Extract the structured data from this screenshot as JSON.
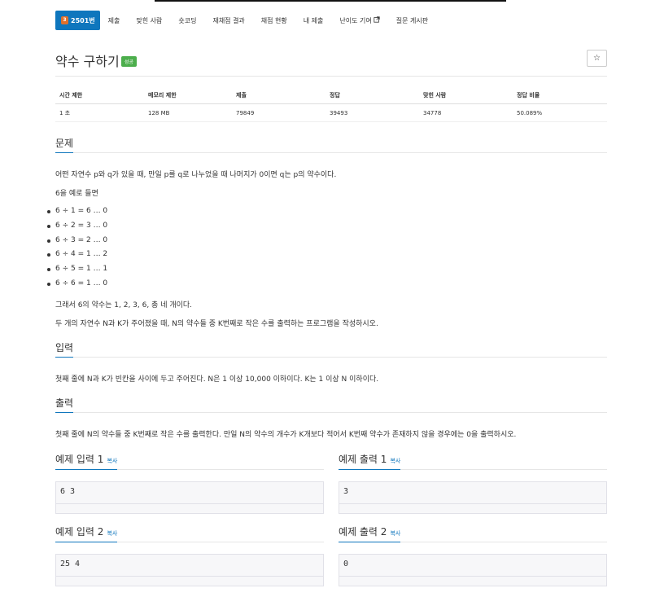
{
  "nav": {
    "problem_tab": {
      "badge": "3",
      "label": "2501번"
    },
    "tabs": [
      "제출",
      "맞힌 사람",
      "숏코딩",
      "재채점 결과",
      "채점 현황",
      "내 제출",
      "난이도 기여",
      "질문 게시판"
    ]
  },
  "problem": {
    "title": "약수 구하기",
    "status_label": "성공",
    "star": "☆"
  },
  "info": {
    "headers": [
      "시간 제한",
      "메모리 제한",
      "제출",
      "정답",
      "맞힌 사람",
      "정답 비율"
    ],
    "values": [
      "1 초",
      "128 MB",
      "79849",
      "39493",
      "34778",
      "50.089%"
    ]
  },
  "description": {
    "heading": "문제",
    "p1": "어떤 자연수 p와 q가 있을 때, 만일 p를 q로 나누었을 때 나머지가 0이면 q는 p의 약수이다.",
    "p2": "6을 예로 들면",
    "examples": [
      "6 ÷ 1 = 6 … 0",
      "6 ÷ 2 = 3 … 0",
      "6 ÷ 3 = 2 … 0",
      "6 ÷ 4 = 1 … 2",
      "6 ÷ 5 = 1 … 1",
      "6 ÷ 6 = 1 … 0"
    ],
    "p3": "그래서 6의 약수는 1, 2, 3, 6, 총 네 개이다.",
    "p4": "두 개의 자연수 N과 K가 주어졌을 때, N의 약수들 중 K번째로 작은 수를 출력하는 프로그램을 작성하시오."
  },
  "input": {
    "heading": "입력",
    "text": "첫째 줄에 N과 K가 빈칸을 사이에 두고 주어진다. N은 1 이상 10,000 이하이다. K는 1 이상 N 이하이다."
  },
  "output": {
    "heading": "출력",
    "text": "첫째 줄에 N의 약수들 중 K번째로 작은 수를 출력한다. 만일 N의 약수의 개수가 K개보다 적어서 K번째 약수가 존재하지 않을 경우에는 0을 출력하시오."
  },
  "samples": {
    "copy_label": "복사",
    "in1_title": "예제 입력 1",
    "in1_value": "6 3",
    "out1_title": "예제 출력 1",
    "out1_value": "3",
    "in2_title": "예제 입력 2",
    "in2_value": "25 4",
    "out2_title": "예제 출력 2",
    "out2_value": "0"
  }
}
